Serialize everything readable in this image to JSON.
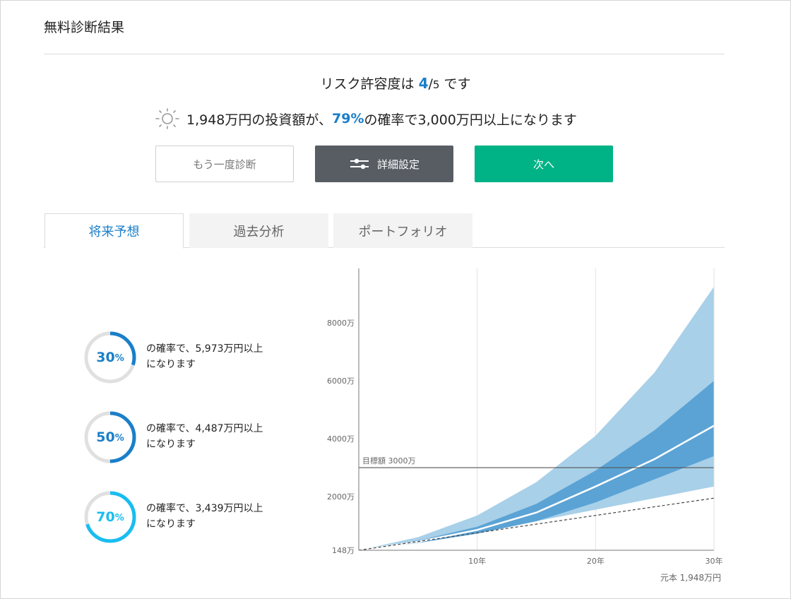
{
  "page": {
    "title": "無料診断結果"
  },
  "risk": {
    "prefix": "リスク許容度は",
    "value": "4",
    "separator": "/",
    "max": "5",
    "suffix": "です"
  },
  "summary": {
    "before": "1,948万円の投資額が、",
    "percent": "79%",
    "after": "の確率で3,000万円以上になります",
    "icon": "sun-icon"
  },
  "buttons": {
    "retry": "もう一度診断",
    "settings": "詳細設定",
    "settings_icon": "sliders-icon",
    "next": "次へ"
  },
  "tabs": [
    {
      "label": "将来予想",
      "active": true
    },
    {
      "label": "過去分析",
      "active": false
    },
    {
      "label": "ポートフォリオ",
      "active": false
    }
  ],
  "probabilities": [
    {
      "percent": "30",
      "unit": "%",
      "line1": "の確率で、5,973万円以上",
      "line2": "になります",
      "color": "#1a7fc9",
      "fraction": 0.3
    },
    {
      "percent": "50",
      "unit": "%",
      "line1": "の確率で、4,487万円以上",
      "line2": "になります",
      "color": "#1a7fc9",
      "fraction": 0.5
    },
    {
      "percent": "70",
      "unit": "%",
      "line1": "の確率で、3,439万円以上",
      "line2": "になります",
      "color": "#19bdf0",
      "fraction": 0.7
    }
  ],
  "chart_data": {
    "type": "area",
    "x": [
      0,
      5,
      10,
      15,
      20,
      25,
      30
    ],
    "xlim": [
      0,
      30
    ],
    "ylim": [
      0,
      9000
    ],
    "ytick_values": [
      148,
      2000,
      4000,
      6000,
      8000
    ],
    "ytick_labels": [
      "148万",
      "2000万",
      "4000万",
      "6000万",
      "8000万"
    ],
    "xtick_values": [
      10,
      20,
      30
    ],
    "xtick_labels": [
      "10年",
      "20年",
      "30年"
    ],
    "grid_x": [
      10,
      20
    ],
    "outer_band": {
      "upper": [
        148,
        600,
        1350,
        2500,
        4100,
        6300,
        9250
      ],
      "lower": [
        148,
        420,
        750,
        1150,
        1550,
        1950,
        2350
      ],
      "color": "#a8d0e8"
    },
    "inner_band": {
      "upper": [
        148,
        480,
        960,
        1750,
        2900,
        4300,
        6000
      ],
      "lower": [
        148,
        400,
        720,
        1150,
        1800,
        2600,
        3400
      ],
      "color": "#5ba3d5"
    },
    "median": {
      "values": [
        148,
        440,
        850,
        1450,
        2350,
        3300,
        4450
      ],
      "color": "#ffffff"
    },
    "principal": {
      "values": [
        148,
        450,
        750,
        1050,
        1350,
        1650,
        1948
      ],
      "label": "元本 1,948万円"
    },
    "target": {
      "value": 3000,
      "label": "目標額 3000万"
    }
  }
}
